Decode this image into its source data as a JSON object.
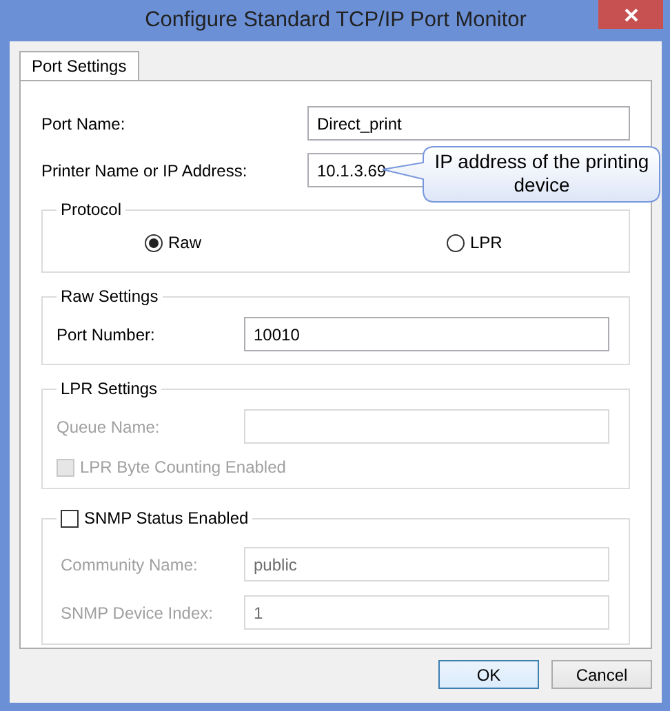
{
  "window": {
    "title": "Configure Standard TCP/IP Port Monitor"
  },
  "tabs": [
    {
      "label": "Port Settings",
      "selected": true
    }
  ],
  "top_fields": [
    {
      "label": "Port Name:",
      "value": "Direct_print",
      "disabled": false
    },
    {
      "label": "Printer Name or IP Address:",
      "value": "10.1.3.69",
      "disabled": false
    }
  ],
  "callout": {
    "text": "IP address of the printing device"
  },
  "protocol": {
    "title": "Protocol",
    "options": [
      {
        "label": "Raw",
        "selected": true
      },
      {
        "label": "LPR",
        "selected": false
      }
    ]
  },
  "raw_settings": {
    "title": "Raw Settings",
    "fields": [
      {
        "label": "Port Number:",
        "value": "10010",
        "disabled": false
      }
    ]
  },
  "lpr_settings": {
    "title": "LPR Settings",
    "fields": [
      {
        "label": "Queue Name:",
        "disabled": true
      }
    ],
    "byte_counting": {
      "label": "LPR Byte Counting Enabled",
      "checked": false,
      "disabled": true
    }
  },
  "snmp": {
    "label": "SNMP Status Enabled",
    "checked": false,
    "fields": [
      {
        "label": "Community Name:",
        "value": "public",
        "disabled": true
      },
      {
        "label": "SNMP Device Index:",
        "value": "1",
        "disabled": true
      }
    ]
  },
  "buttons": [
    {
      "label": "OK",
      "default": true
    },
    {
      "label": "Cancel",
      "default": false
    }
  ]
}
